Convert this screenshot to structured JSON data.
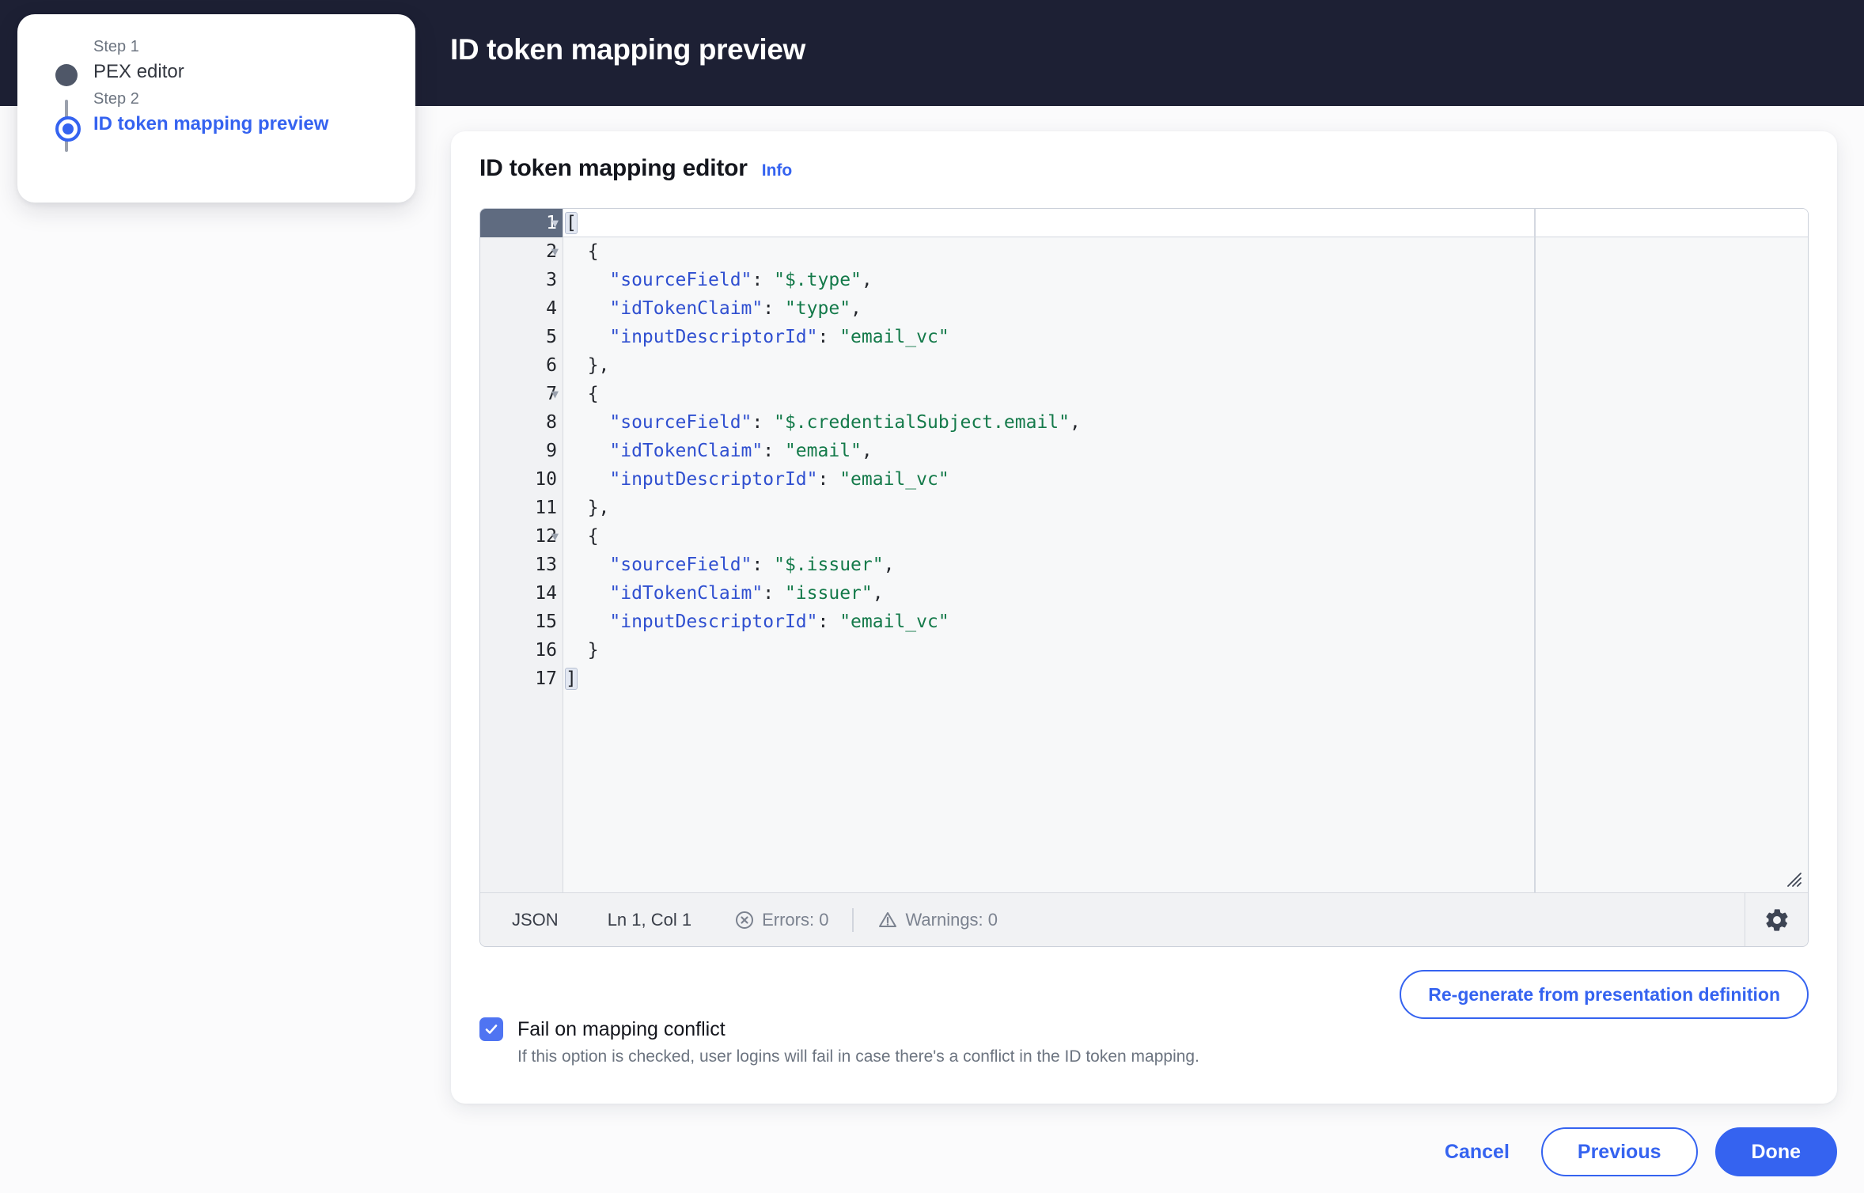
{
  "header": {
    "title": "ID token mapping preview",
    "background_color": "#1d2034"
  },
  "stepper": {
    "steps": [
      {
        "step_label": "Step 1",
        "name": "PEX editor",
        "state": "completed"
      },
      {
        "step_label": "Step 2",
        "name": "ID token mapping preview",
        "state": "active"
      }
    ]
  },
  "card": {
    "title": "ID token mapping editor",
    "info_link": "Info"
  },
  "editor": {
    "language": "JSON",
    "cursor": "Ln 1, Col 1",
    "errors_label": "Errors: 0",
    "warnings_label": "Warnings: 0",
    "settings_icon": "gear-icon",
    "error_icon": "error-circle-icon",
    "warning_icon": "warning-triangle-icon",
    "resize_icon": "resize-grip-icon",
    "active_line": 1,
    "lines": [
      {
        "n": 1,
        "fold": true,
        "tokens": [
          {
            "t": "pun",
            "v": "["
          }
        ]
      },
      {
        "n": 2,
        "fold": true,
        "tokens": [
          {
            "t": "pun",
            "v": "  {"
          }
        ]
      },
      {
        "n": 3,
        "fold": false,
        "tokens": [
          {
            "t": "key",
            "v": "    \"sourceField\""
          },
          {
            "t": "pun",
            "v": ": "
          },
          {
            "t": "str",
            "v": "\"$.type\""
          },
          {
            "t": "pun",
            "v": ","
          }
        ]
      },
      {
        "n": 4,
        "fold": false,
        "tokens": [
          {
            "t": "key",
            "v": "    \"idTokenClaim\""
          },
          {
            "t": "pun",
            "v": ": "
          },
          {
            "t": "str",
            "v": "\"type\""
          },
          {
            "t": "pun",
            "v": ","
          }
        ]
      },
      {
        "n": 5,
        "fold": false,
        "tokens": [
          {
            "t": "key",
            "v": "    \"inputDescriptorId\""
          },
          {
            "t": "pun",
            "v": ": "
          },
          {
            "t": "str",
            "v": "\"email_vc\""
          }
        ]
      },
      {
        "n": 6,
        "fold": false,
        "tokens": [
          {
            "t": "pun",
            "v": "  },"
          }
        ]
      },
      {
        "n": 7,
        "fold": true,
        "tokens": [
          {
            "t": "pun",
            "v": "  {"
          }
        ]
      },
      {
        "n": 8,
        "fold": false,
        "tokens": [
          {
            "t": "key",
            "v": "    \"sourceField\""
          },
          {
            "t": "pun",
            "v": ": "
          },
          {
            "t": "str",
            "v": "\"$.credentialSubject.email\""
          },
          {
            "t": "pun",
            "v": ","
          }
        ]
      },
      {
        "n": 9,
        "fold": false,
        "tokens": [
          {
            "t": "key",
            "v": "    \"idTokenClaim\""
          },
          {
            "t": "pun",
            "v": ": "
          },
          {
            "t": "str",
            "v": "\"email\""
          },
          {
            "t": "pun",
            "v": ","
          }
        ]
      },
      {
        "n": 10,
        "fold": false,
        "tokens": [
          {
            "t": "key",
            "v": "    \"inputDescriptorId\""
          },
          {
            "t": "pun",
            "v": ": "
          },
          {
            "t": "str",
            "v": "\"email_vc\""
          }
        ]
      },
      {
        "n": 11,
        "fold": false,
        "tokens": [
          {
            "t": "pun",
            "v": "  },"
          }
        ]
      },
      {
        "n": 12,
        "fold": true,
        "tokens": [
          {
            "t": "pun",
            "v": "  {"
          }
        ]
      },
      {
        "n": 13,
        "fold": false,
        "tokens": [
          {
            "t": "key",
            "v": "    \"sourceField\""
          },
          {
            "t": "pun",
            "v": ": "
          },
          {
            "t": "str",
            "v": "\"$.issuer\""
          },
          {
            "t": "pun",
            "v": ","
          }
        ]
      },
      {
        "n": 14,
        "fold": false,
        "tokens": [
          {
            "t": "key",
            "v": "    \"idTokenClaim\""
          },
          {
            "t": "pun",
            "v": ": "
          },
          {
            "t": "str",
            "v": "\"issuer\""
          },
          {
            "t": "pun",
            "v": ","
          }
        ]
      },
      {
        "n": 15,
        "fold": false,
        "tokens": [
          {
            "t": "key",
            "v": "    \"inputDescriptorId\""
          },
          {
            "t": "pun",
            "v": ": "
          },
          {
            "t": "str",
            "v": "\"email_vc\""
          }
        ]
      },
      {
        "n": 16,
        "fold": false,
        "tokens": [
          {
            "t": "pun",
            "v": "  }"
          }
        ]
      },
      {
        "n": 17,
        "fold": false,
        "tokens": [
          {
            "t": "pun",
            "v": "]"
          }
        ]
      }
    ]
  },
  "actions": {
    "regenerate": "Re-generate from presentation definition"
  },
  "option": {
    "checked": true,
    "label": "Fail on mapping conflict",
    "help": "If this option is checked, user logins will fail in case there's a conflict in the ID token mapping."
  },
  "footer": {
    "cancel": "Cancel",
    "previous": "Previous",
    "done": "Done"
  },
  "colors": {
    "accent": "#3563f0",
    "header_bg": "#1d2034",
    "page_bg": "#fbfbfc",
    "json_key": "#2f4fd0",
    "json_string": "#147a4a",
    "active_gutter": "#5f6b80"
  }
}
